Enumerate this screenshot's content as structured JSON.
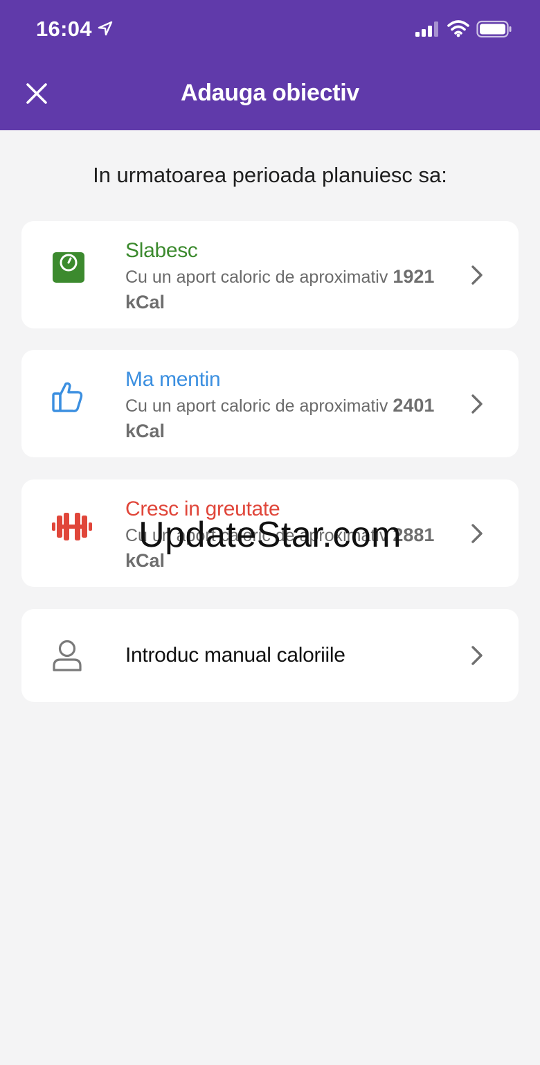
{
  "status_bar": {
    "time": "16:04"
  },
  "header": {
    "title": "Adauga obiectiv"
  },
  "prompt": "In urmatoarea perioada planuiesc sa:",
  "options": [
    {
      "title": "Slabesc",
      "desc": "Cu un aport caloric de aproximativ",
      "kcal": "1921",
      "unit": "kCal",
      "color": "#3c8a2e",
      "icon": "scale-icon"
    },
    {
      "title": "Ma mentin",
      "desc": "Cu un aport caloric de aproximativ",
      "kcal": "2401",
      "unit": "kCal",
      "color": "#3b8fe0",
      "icon": "thumbs-up-icon"
    },
    {
      "title": "Cresc in greutate",
      "desc": "Cu un aport caloric de aproximativ",
      "kcal": "2881",
      "unit": "kCal",
      "color": "#e0463a",
      "icon": "dumbbell-icon"
    }
  ],
  "manual": {
    "label": "Introduc manual caloriile",
    "icon": "person-icon"
  },
  "watermark": "UpdateStar.com",
  "colors": {
    "header": "#603aaa",
    "background": "#f4f4f5",
    "card": "#ffffff"
  }
}
